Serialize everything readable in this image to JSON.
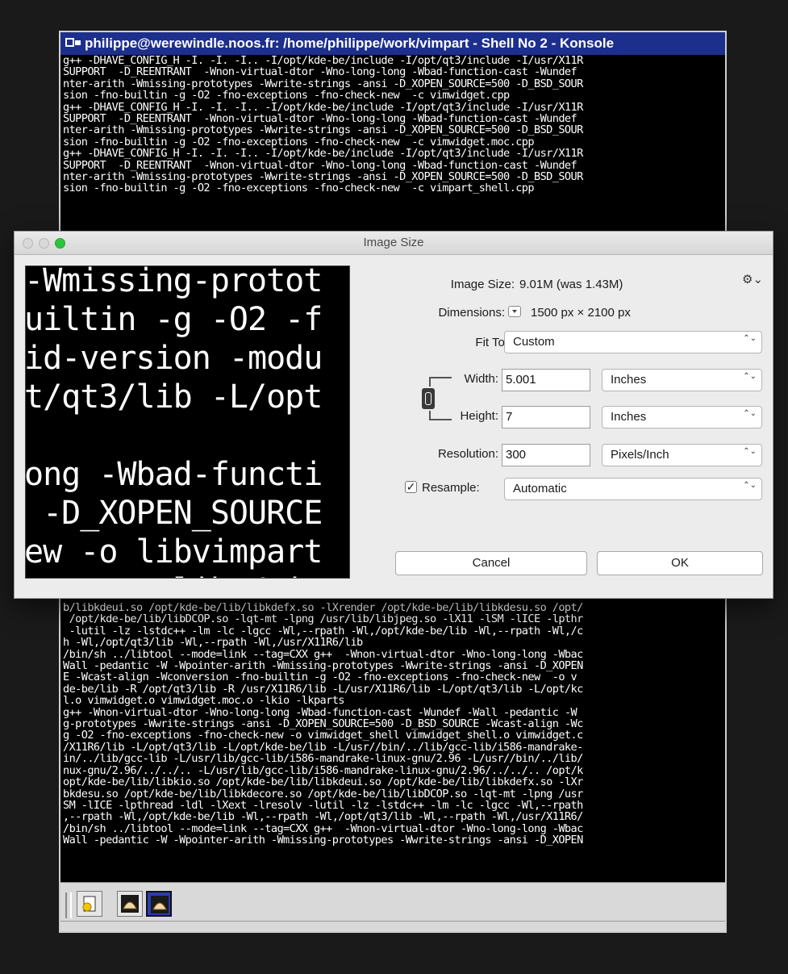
{
  "konsole": {
    "title": "philippe@werewindle.noos.fr: /home/philippe/work/vimpart - Shell No 2 - Konsole",
    "top_lines": [
      "g++ -DHAVE_CONFIG_H -I. -I. -I.. -I/opt/kde-be/include -I/opt/qt3/include -I/usr/X11R",
      "SUPPORT  -D_REENTRANT  -Wnon-virtual-dtor -Wno-long-long -Wbad-function-cast -Wundef",
      "nter-arith -Wmissing-prototypes -Wwrite-strings -ansi -D_XOPEN_SOURCE=500 -D_BSD_SOUR",
      "sion -fno-builtin -g -O2 -fno-exceptions -fno-check-new  -c vimwidget.cpp",
      "g++ -DHAVE_CONFIG_H -I. -I. -I.. -I/opt/kde-be/include -I/opt/qt3/include -I/usr/X11R",
      "SUPPORT  -D_REENTRANT  -Wnon-virtual-dtor -Wno-long-long -Wbad-function-cast -Wundef",
      "nter-arith -Wmissing-prototypes -Wwrite-strings -ansi -D_XOPEN_SOURCE=500 -D_BSD_SOUR",
      "sion -fno-builtin -g -O2 -fno-exceptions -fno-check-new  -c vimwidget.moc.cpp",
      "g++ -DHAVE_CONFIG_H -I. -I. -I.. -I/opt/kde-be/include -I/opt/qt3/include -I/usr/X11R",
      "SUPPORT  -D_REENTRANT  -Wnon-virtual-dtor -Wno-long-long -Wbad-function-cast -Wundef",
      "nter-arith -Wmissing-prototypes -Wwrite-strings -ansi -D_XOPEN_SOURCE=500 -D_BSD_SOUR",
      "sion -fno-builtin -g -O2 -fno-exceptions -fno-check-new  -c vimpart_shell.cpp"
    ],
    "bottom_lines": [
      "b/libkdeui.so /opt/kde-be/lib/libkdefx.so -lXrender /opt/kde-be/lib/libkdesu.so /opt/",
      " /opt/kde-be/lib/libDCOP.so -lqt-mt -lpng /usr/lib/libjpeg.so -lX11 -lSM -lICE -lpthr",
      " -lutil -lz -lstdc++ -lm -lc -lgcc -Wl,--rpath -Wl,/opt/kde-be/lib -Wl,--rpath -Wl,/c",
      "h -Wl,/opt/qt3/lib -Wl,--rpath -Wl,/usr/X11R6/lib",
      "/bin/sh ../libtool --mode=link --tag=CXX g++  -Wnon-virtual-dtor -Wno-long-long -Wbac",
      "Wall -pedantic -W -Wpointer-arith -Wmissing-prototypes -Wwrite-strings -ansi -D_XOPEN",
      "E -Wcast-align -Wconversion -fno-builtin -g -O2 -fno-exceptions -fno-check-new  -o v",
      "de-be/lib -R /opt/qt3/lib -R /usr/X11R6/lib -L/usr/X11R6/lib -L/opt/qt3/lib -L/opt/kc",
      "l.o vimwidget.o vimwidget.moc.o -lkio -lkparts",
      "g++ -Wnon-virtual-dtor -Wno-long-long -Wbad-function-cast -Wundef -Wall -pedantic -W",
      "g-prototypes -Wwrite-strings -ansi -D_XOPEN_SOURCE=500 -D_BSD_SOURCE -Wcast-align -Wc",
      "g -O2 -fno-exceptions -fno-check-new -o vimwidget_shell vimwidget_shell.o vimwidget.c",
      "/X11R6/lib -L/opt/qt3/lib -L/opt/kde-be/lib -L/usr//bin/../lib/gcc-lib/i586-mandrake-",
      "in/../lib/gcc-lib -L/usr/lib/gcc-lib/i586-mandrake-linux-gnu/2.96 -L/usr//bin/../lib/",
      "nux-gnu/2.96/../../.. -L/usr/lib/gcc-lib/i586-mandrake-linux-gnu/2.96/../../.. /opt/k",
      "opt/kde-be/lib/libkio.so /opt/kde-be/lib/libkdeui.so /opt/kde-be/lib/libkdefx.so -lXr",
      "bkdesu.so /opt/kde-be/lib/libkdecore.so /opt/kde-be/lib/libDCOP.so -lqt-mt -lpng /usr",
      "SM -lICE -lpthread -ldl -lXext -lresolv -lutil -lz -lstdc++ -lm -lc -lgcc -Wl,--rpath",
      ",--rpath -Wl,/opt/kde-be/lib -Wl,--rpath -Wl,/opt/qt3/lib -Wl,--rpath -Wl,/usr/X11R6/",
      "/bin/sh ../libtool --mode=link --tag=CXX g++  -Wnon-virtual-dtor -Wno-long-long -Wbac",
      "Wall -pedantic -W -Wpointer-arith -Wmissing-prototypes -Wwrite-strings -ansi -D_XOPEN"
    ]
  },
  "dialog": {
    "title": "Image Size",
    "preview_lines": [
      "-Wmissing-protot",
      "uiltin -g -O2 -f",
      "id-version -modu",
      "t/qt3/lib -L/opt",
      "",
      "ong -Wbad-functi",
      " -D_XOPEN_SOURCE",
      "ew -o libvimpart",
      "tory.o .libs/vim"
    ],
    "image_size_label": "Image Size:",
    "image_size_value": "9.01M (was 1.43M)",
    "dimensions_label": "Dimensions:",
    "dimensions_value": "1500 px  ×  2100 px",
    "fit_to_label": "Fit To:",
    "fit_to_value": "Custom",
    "width_label": "Width:",
    "width_value": "5.001",
    "width_unit": "Inches",
    "height_label": "Height:",
    "height_value": "7",
    "height_unit": "Inches",
    "resolution_label": "Resolution:",
    "resolution_value": "300",
    "resolution_unit": "Pixels/Inch",
    "resample_label": "Resample:",
    "resample_checked": "✓",
    "resample_value": "Automatic",
    "cancel_label": "Cancel",
    "ok_label": "OK",
    "gear_glyph": "⚙⌄",
    "popup_arrows": "⌃⌄"
  }
}
